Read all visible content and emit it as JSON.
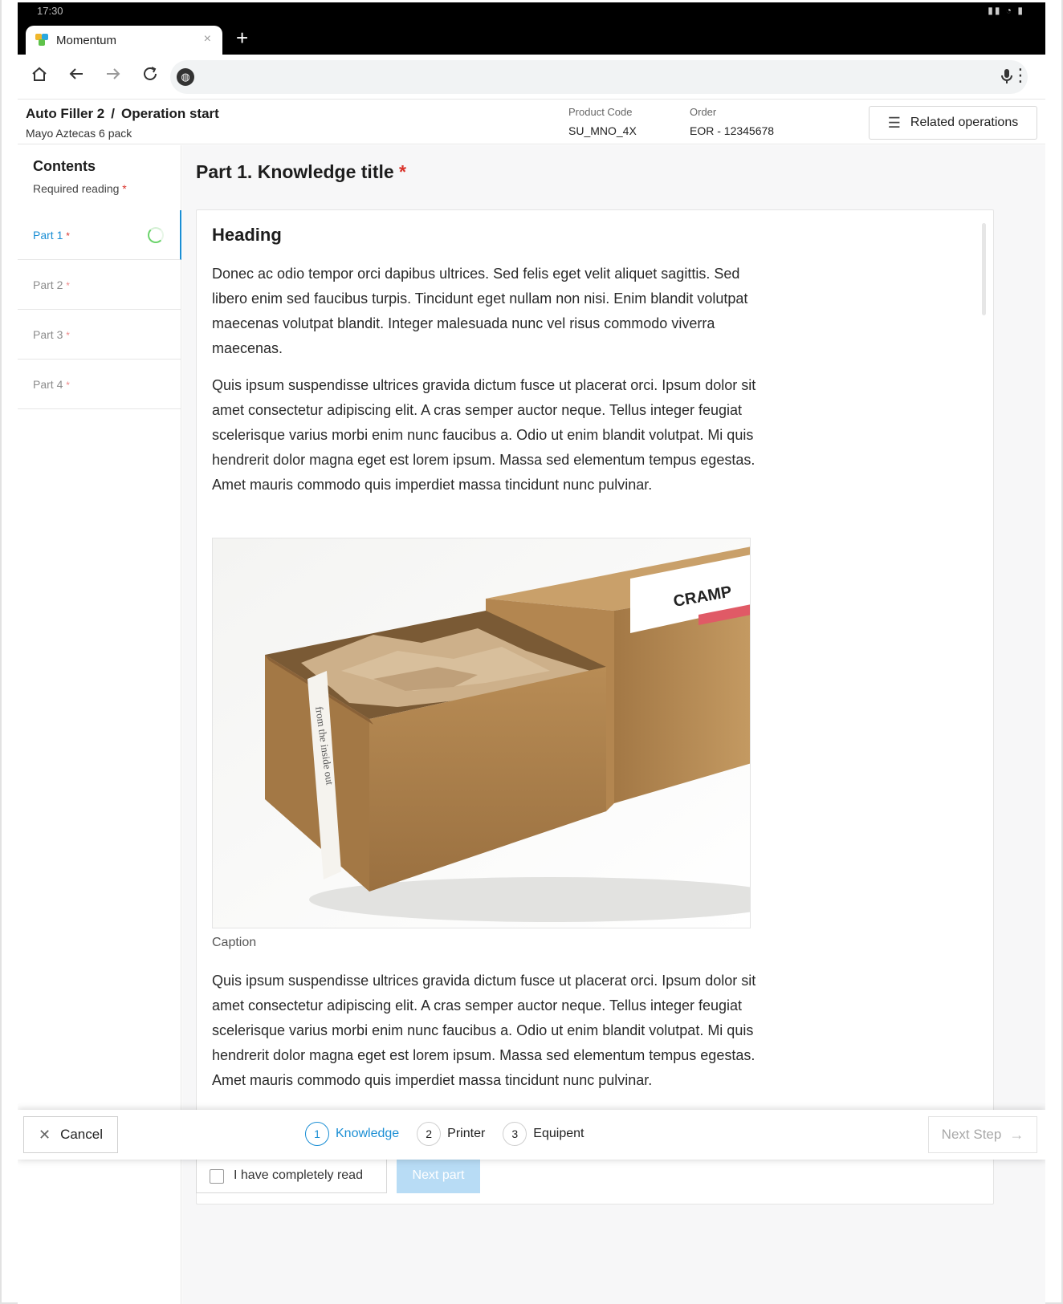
{
  "status_bar": {
    "time": "17:30",
    "icons": "signal-wifi-battery"
  },
  "browser": {
    "tab_title": "Momentum",
    "tab_close": "×",
    "new_tab": "+",
    "icons": [
      "home-icon",
      "back-arrow-icon",
      "forward-arrow-icon",
      "reload-icon",
      "globe-icon",
      "mic-icon",
      "more-vert-icon"
    ]
  },
  "header": {
    "machine": "Auto Filler 2",
    "separator": "/",
    "operation": "Operation start",
    "subtitle": "Mayo Aztecas 6 pack",
    "product_code_label": "Product Code",
    "product_code": "SU_MNO_4X",
    "order_label": "Order",
    "order": "EOR - 12345678",
    "related_button": "Related operations"
  },
  "sidebar": {
    "title": "Contents",
    "required_label": "Required reading",
    "required_marker": "*",
    "parts": [
      {
        "label": "Part 1",
        "marker": "*",
        "active": true
      },
      {
        "label": "Part 2",
        "marker": "*",
        "active": false
      },
      {
        "label": "Part 3",
        "marker": "*",
        "active": false
      },
      {
        "label": "Part 4",
        "marker": "*",
        "active": false
      }
    ]
  },
  "main": {
    "title": "Part 1. Knowledge title",
    "title_marker": "*",
    "heading": "Heading",
    "paragraphs": [
      "Donec ac odio tempor orci dapibus ultrices. Sed felis eget velit aliquet sagittis. Sed libero enim sed faucibus turpis. Tincidunt eget nullam non nisi. Enim blandit volutpat maecenas volutpat blandit. Integer malesuada nunc vel risus commodo viverra maecenas.",
      "Quis ipsum suspendisse ultrices gravida dictum fusce ut placerat orci. Ipsum dolor sit amet consectetur adipiscing elit. A cras semper auctor neque. Tellus integer feugiat scelerisque varius morbi enim nunc faucibus a. Odio ut enim blandit volutpat. Mi quis hendrerit dolor magna eget est lorem ipsum. Massa sed elementum tempus egestas. Amet mauris commodo quis imperdiet massa tincidunt nunc pulvinar.",
      "Quis ipsum suspendisse ultrices gravida dictum fusce ut placerat orci. Ipsum dolor sit amet consectetur adipiscing elit. A cras semper auctor neque. Tellus integer feugiat scelerisque varius morbi enim nunc faucibus a. Odio ut enim blandit volutpat. Mi quis hendrerit dolor magna eget est lorem ipsum. Massa sed elementum tempus egestas. Amet mauris commodo quis imperdiet massa tincidunt nunc pulvinar."
    ],
    "image_label_text": "CRAMP",
    "image_ribbon_text": "from the inside out",
    "caption": "Caption",
    "read_checkbox_label": "I have completely read",
    "next_part_button": "Next part"
  },
  "footer": {
    "cancel_button": "Cancel",
    "steps": [
      {
        "number": "1",
        "label": "Knowledge",
        "active": true
      },
      {
        "number": "2",
        "label": "Printer",
        "active": false
      },
      {
        "number": "3",
        "label": "Equipent",
        "active": false
      }
    ],
    "next_step_button": "Next Step"
  },
  "colors": {
    "accent": "#1a8ed4",
    "required": "#d9322a",
    "progress_ring": "#6bd36b",
    "kraft": "#b3874f"
  }
}
